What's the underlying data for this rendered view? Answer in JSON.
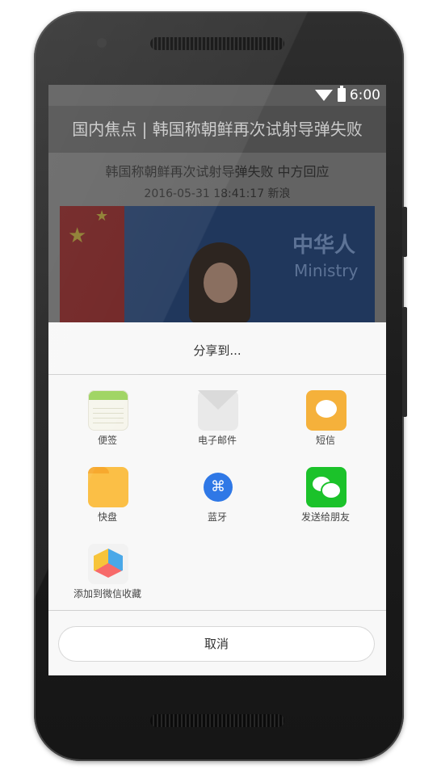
{
  "status_bar": {
    "time": "6:00"
  },
  "background_page": {
    "header_title": "国内焦点 | 韩国称朝鲜再次试射导弹失败",
    "article_title": "韩国称朝鲜再次试射导弹失败 中方回应",
    "article_meta": "2016-05-31 18:41:17   新浪",
    "photo_text_1": "中华人",
    "photo_text_2": "Ministry"
  },
  "share_sheet": {
    "title": "分享到...",
    "items": [
      {
        "label": "便签",
        "icon": "notes-icon"
      },
      {
        "label": "电子邮件",
        "icon": "mail-icon"
      },
      {
        "label": "短信",
        "icon": "sms-icon"
      },
      {
        "label": "快盘",
        "icon": "folder-icon"
      },
      {
        "label": "蓝牙",
        "icon": "bluetooth-icon"
      },
      {
        "label": "发送给朋友",
        "icon": "wechat-icon"
      },
      {
        "label": "添加到微信收藏",
        "icon": "favorites-cube-icon"
      }
    ],
    "cancel_label": "取消"
  }
}
